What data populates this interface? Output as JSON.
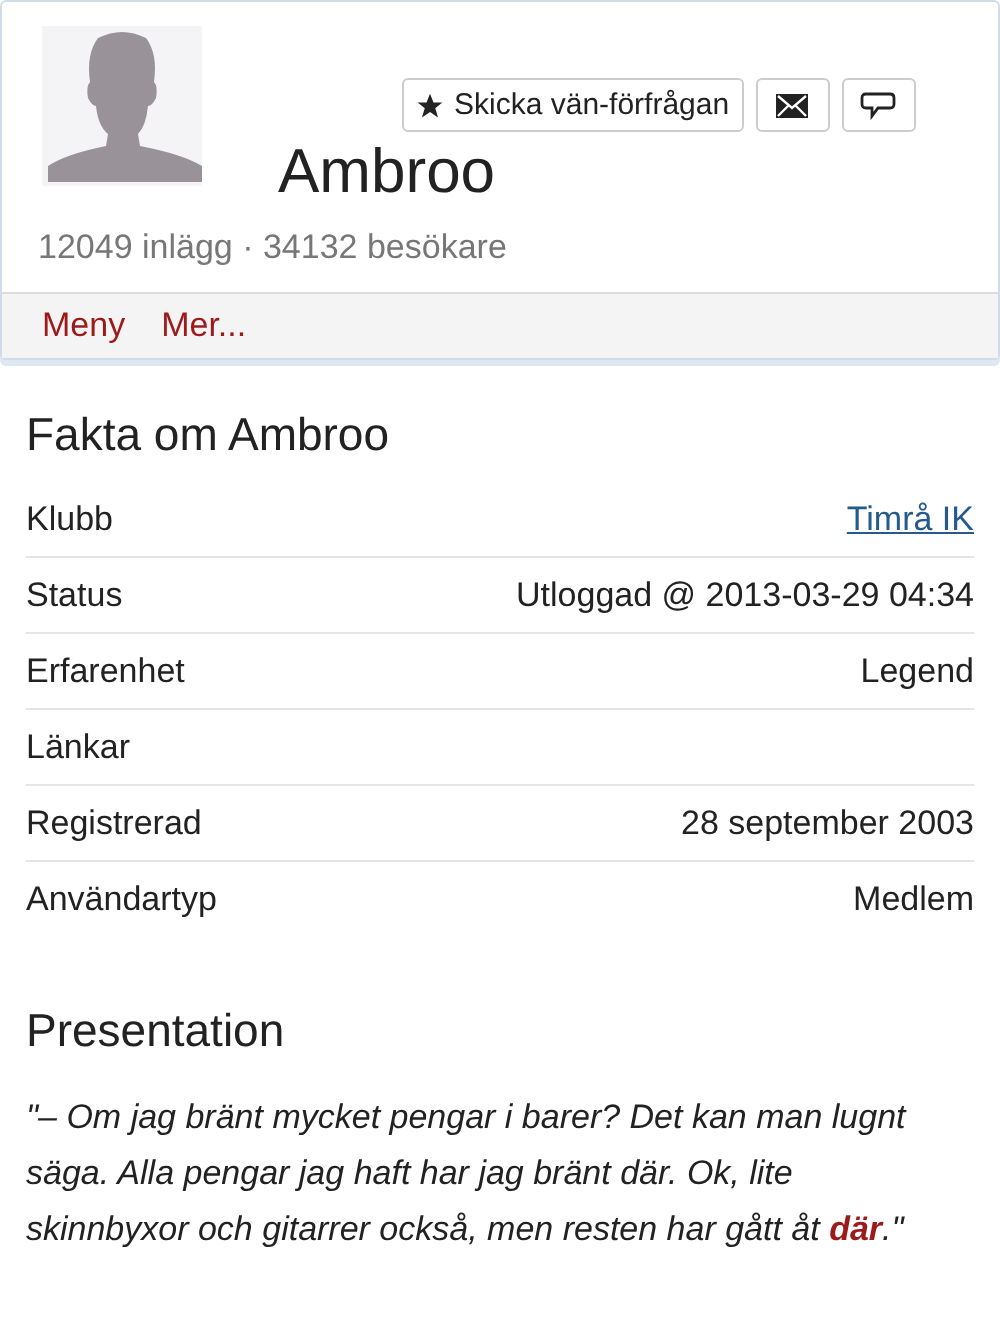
{
  "profile": {
    "name": "Ambroo",
    "stats": "12049 inlägg · 34132 besökare",
    "friend_button": "Skicka vän-förfrågan"
  },
  "menu": [
    "Meny",
    "Mer..."
  ],
  "facts": {
    "title": "Fakta om Ambroo",
    "rows": [
      {
        "label": "Klubb",
        "value": "Timrå IK",
        "kind": "link"
      },
      {
        "label": "Status",
        "value": "Utloggad @ 2013-03-29 04:34",
        "kind": "text"
      },
      {
        "label": "Erfarenhet",
        "value": "Legend",
        "kind": "text"
      },
      {
        "label": "Länkar"
      },
      {
        "label": "Registrerad",
        "value": "28 september 2003",
        "kind": "text"
      },
      {
        "label": "Användartyp",
        "value": "Medlem",
        "kind": "text"
      }
    ]
  },
  "presentation": {
    "title": "Presentation",
    "text": "\"– Om jag bränt mycket pengar i barer? Det kan man lugnt säga. Alla pengar jag haft har jag bränt där. Ok, lite skinnbyxor och gitarrer också, men resten har gått åt **där**.\""
  }
}
